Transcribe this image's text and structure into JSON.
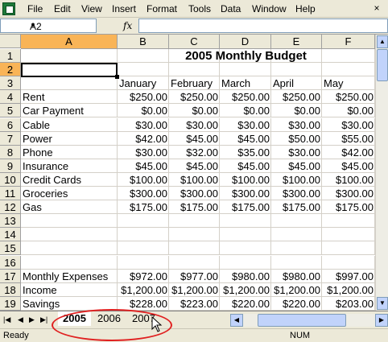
{
  "menu": {
    "items": [
      {
        "label": "File"
      },
      {
        "label": "Edit"
      },
      {
        "label": "View"
      },
      {
        "label": "Insert"
      },
      {
        "label": "Format"
      },
      {
        "label": "Tools"
      },
      {
        "label": "Data"
      },
      {
        "label": "Window"
      },
      {
        "label": "Help"
      }
    ],
    "close": "×"
  },
  "formula_bar": {
    "name_box": "A2",
    "fx": "fx",
    "value": ""
  },
  "columns": [
    "A",
    "B",
    "C",
    "D",
    "E",
    "F"
  ],
  "selected_column": "A",
  "selected_row": "2",
  "rows": [
    "1",
    "2",
    "3",
    "4",
    "5",
    "6",
    "7",
    "8",
    "9",
    "10",
    "11",
    "12",
    "13",
    "14",
    "15",
    "16",
    "17",
    "18",
    "19"
  ],
  "sheet": {
    "title": "2005 Monthly Budget",
    "months": [
      "January",
      "February",
      "March",
      "April",
      "May"
    ],
    "expense_rows": [
      {
        "label": "Rent",
        "values": [
          "$250.00",
          "$250.00",
          "$250.00",
          "$250.00",
          "$250.00"
        ]
      },
      {
        "label": "Car Payment",
        "values": [
          "$0.00",
          "$0.00",
          "$0.00",
          "$0.00",
          "$0.00"
        ]
      },
      {
        "label": "Cable",
        "values": [
          "$30.00",
          "$30.00",
          "$30.00",
          "$30.00",
          "$30.00"
        ]
      },
      {
        "label": "Power",
        "values": [
          "$42.00",
          "$45.00",
          "$45.00",
          "$50.00",
          "$55.00"
        ]
      },
      {
        "label": "Phone",
        "values": [
          "$30.00",
          "$32.00",
          "$35.00",
          "$30.00",
          "$42.00"
        ]
      },
      {
        "label": "Insurance",
        "values": [
          "$45.00",
          "$45.00",
          "$45.00",
          "$45.00",
          "$45.00"
        ]
      },
      {
        "label": "Credit Cards",
        "values": [
          "$100.00",
          "$100.00",
          "$100.00",
          "$100.00",
          "$100.00"
        ]
      },
      {
        "label": "Groceries",
        "values": [
          "$300.00",
          "$300.00",
          "$300.00",
          "$300.00",
          "$300.00"
        ]
      },
      {
        "label": "Gas",
        "values": [
          "$175.00",
          "$175.00",
          "$175.00",
          "$175.00",
          "$175.00"
        ]
      }
    ],
    "summary_rows": [
      {
        "label": "Monthly Expenses",
        "values": [
          "$972.00",
          "$977.00",
          "$980.00",
          "$980.00",
          "$997.00"
        ]
      },
      {
        "label": "Income",
        "values": [
          "$1,200.00",
          "$1,200.00",
          "$1,200.00",
          "$1,200.00",
          "$1,200.00"
        ]
      },
      {
        "label": "Savings",
        "values": [
          "$228.00",
          "$223.00",
          "$220.00",
          "$220.00",
          "$203.00"
        ]
      }
    ]
  },
  "tabs": [
    {
      "label": "2005",
      "active": true
    },
    {
      "label": "2006",
      "active": false
    },
    {
      "label": "2007",
      "active": false
    }
  ],
  "status": {
    "left": "Ready",
    "num": "NUM"
  },
  "colors": {
    "selected_header": "#f9b457",
    "highlight": "#e02020"
  }
}
